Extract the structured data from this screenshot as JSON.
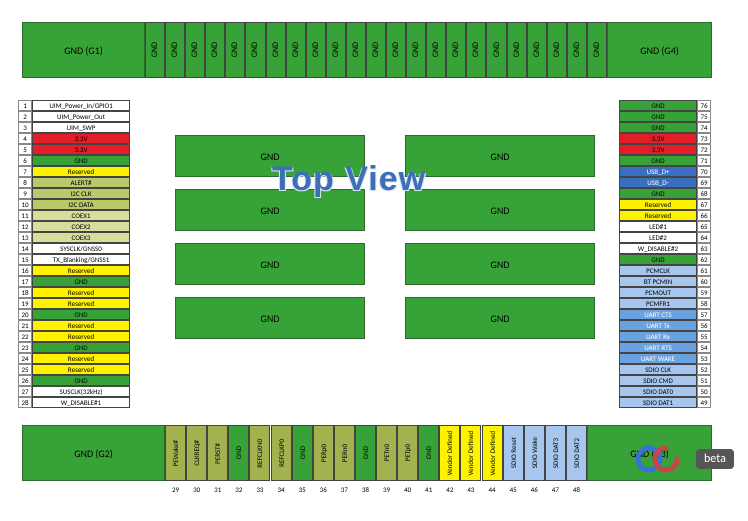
{
  "title": "Top View",
  "logo": {
    "text": "oc",
    "badge": "beta"
  },
  "colors": {
    "green": "#37a237",
    "greenDark": "#2e6a2e",
    "olive": "#bcc96b",
    "oliveDark": "#a3b24f",
    "yellow": "#fef200",
    "red": "#e41e26",
    "white": "#ffffff",
    "blue": "#3a6fbf",
    "blueMid": "#6aa2e0",
    "blueLight": "#a7c6ed",
    "oliveLight": "#d7dd9c"
  },
  "corner_blocks": {
    "G1": "GND (G1)",
    "G2": "GND (G2)",
    "G3": "GND (G3)",
    "G4": "GND (G4)"
  },
  "gnd_label": "GND",
  "inner_blocks_rows": 4,
  "inner_blocks_cols": 2,
  "inner_block_label": "GND",
  "top_strip": {
    "count": 23,
    "labelEach": "GND"
  },
  "left_pins": [
    {
      "n": 1,
      "label": "UIM_Power_In/GPIO1",
      "color": "white"
    },
    {
      "n": 2,
      "label": "UIM_Power_Out",
      "color": "white"
    },
    {
      "n": 3,
      "label": "UIM_SWP",
      "color": "white"
    },
    {
      "n": 4,
      "label": "3.3V",
      "color": "red"
    },
    {
      "n": 5,
      "label": "3.3V",
      "color": "red"
    },
    {
      "n": 6,
      "label": "GND",
      "color": "green"
    },
    {
      "n": 7,
      "label": "Reserved",
      "color": "yellow"
    },
    {
      "n": 8,
      "label": "ALERT#",
      "color": "olive"
    },
    {
      "n": 9,
      "label": "I2C CLK",
      "color": "olive"
    },
    {
      "n": 10,
      "label": "I2C DATA",
      "color": "olive"
    },
    {
      "n": 11,
      "label": "COEX1",
      "color": "oliveLight"
    },
    {
      "n": 12,
      "label": "COEX2",
      "color": "oliveLight"
    },
    {
      "n": 13,
      "label": "COEX3",
      "color": "oliveLight"
    },
    {
      "n": 14,
      "label": "SYSCLK/GNSS0",
      "color": "white"
    },
    {
      "n": 15,
      "label": "TX_Blanking/GNSS1",
      "color": "white"
    },
    {
      "n": 16,
      "label": "Reserved",
      "color": "yellow"
    },
    {
      "n": 17,
      "label": "GND",
      "color": "green"
    },
    {
      "n": 18,
      "label": "Reserved",
      "color": "yellow"
    },
    {
      "n": 19,
      "label": "Reserved",
      "color": "yellow"
    },
    {
      "n": 20,
      "label": "GND",
      "color": "green"
    },
    {
      "n": 21,
      "label": "Reserved",
      "color": "yellow"
    },
    {
      "n": 22,
      "label": "Reserved",
      "color": "yellow"
    },
    {
      "n": 23,
      "label": "GND",
      "color": "green"
    },
    {
      "n": 24,
      "label": "Reserved",
      "color": "yellow"
    },
    {
      "n": 25,
      "label": "Reserved",
      "color": "yellow"
    },
    {
      "n": 26,
      "label": "GND",
      "color": "green"
    },
    {
      "n": 27,
      "label": "SUSCLK(32kHz)",
      "color": "white"
    },
    {
      "n": 28,
      "label": "W_DISABLE#1",
      "color": "white"
    }
  ],
  "right_pins": [
    {
      "n": 76,
      "label": "GND",
      "color": "green"
    },
    {
      "n": 75,
      "label": "GND",
      "color": "green"
    },
    {
      "n": 74,
      "label": "GND",
      "color": "green"
    },
    {
      "n": 73,
      "label": "3.3V",
      "color": "red"
    },
    {
      "n": 72,
      "label": "3.3V",
      "color": "red"
    },
    {
      "n": 71,
      "label": "GND",
      "color": "green"
    },
    {
      "n": 70,
      "label": "USB_D+",
      "color": "blue"
    },
    {
      "n": 69,
      "label": "USB_D-",
      "color": "blue"
    },
    {
      "n": 68,
      "label": "GND",
      "color": "green"
    },
    {
      "n": 67,
      "label": "Reserved",
      "color": "yellow"
    },
    {
      "n": 66,
      "label": "Reserved",
      "color": "yellow"
    },
    {
      "n": 65,
      "label": "LED#1",
      "color": "white"
    },
    {
      "n": 64,
      "label": "LED#2",
      "color": "white"
    },
    {
      "n": 63,
      "label": "W_DISABLE#2",
      "color": "white"
    },
    {
      "n": 62,
      "label": "GND",
      "color": "green"
    },
    {
      "n": 61,
      "label": "PCMCLK",
      "color": "blueLight"
    },
    {
      "n": 60,
      "label": "BT PCMIN",
      "color": "blueLight"
    },
    {
      "n": 59,
      "label": "PCMOUT",
      "color": "blueLight"
    },
    {
      "n": 58,
      "label": "PCMFR1",
      "color": "blueLight"
    },
    {
      "n": 57,
      "label": "UART CTS",
      "color": "blueMid"
    },
    {
      "n": 56,
      "label": "UART Tx",
      "color": "blueMid"
    },
    {
      "n": 55,
      "label": "UART Rx",
      "color": "blueMid"
    },
    {
      "n": 54,
      "label": "UART RTS",
      "color": "blueMid"
    },
    {
      "n": 53,
      "label": "UART WAKE",
      "color": "blueMid"
    },
    {
      "n": 52,
      "label": "SDIO CLK",
      "color": "blueLight"
    },
    {
      "n": 51,
      "label": "SDIO CMD",
      "color": "blueLight"
    },
    {
      "n": 50,
      "label": "SDIO DAT0",
      "color": "blueLight"
    },
    {
      "n": 49,
      "label": "SDIO DAT1",
      "color": "blueLight"
    }
  ],
  "bottom_pins": [
    {
      "n": 29,
      "label": "PEWake#",
      "color": "oliveDark"
    },
    {
      "n": 30,
      "label": "CLKREQ#",
      "color": "oliveDark"
    },
    {
      "n": 31,
      "label": "PERST#",
      "color": "oliveDark"
    },
    {
      "n": 32,
      "label": "GND",
      "color": "green"
    },
    {
      "n": 33,
      "label": "REFCLKN0",
      "color": "oliveDark"
    },
    {
      "n": 34,
      "label": "REFCLKP0",
      "color": "oliveDark"
    },
    {
      "n": 35,
      "label": "GND",
      "color": "green"
    },
    {
      "n": 36,
      "label": "PERp0",
      "color": "oliveDark"
    },
    {
      "n": 37,
      "label": "PERn0",
      "color": "oliveDark"
    },
    {
      "n": 38,
      "label": "GND",
      "color": "green"
    },
    {
      "n": 39,
      "label": "PETn0",
      "color": "oliveDark"
    },
    {
      "n": 40,
      "label": "PETp0",
      "color": "oliveDark"
    },
    {
      "n": 41,
      "label": "GND",
      "color": "green"
    },
    {
      "n": 42,
      "label": "Vendor Defined",
      "color": "yellow"
    },
    {
      "n": 43,
      "label": "Vendor Defined",
      "color": "yellow"
    },
    {
      "n": 44,
      "label": "Vendor Defined",
      "color": "yellow"
    },
    {
      "n": 45,
      "label": "SDIO Reset",
      "color": "blueLight"
    },
    {
      "n": 46,
      "label": "SDIO Wake",
      "color": "blueLight"
    },
    {
      "n": 47,
      "label": "SDIO DAT3",
      "color": "blueLight"
    },
    {
      "n": 48,
      "label": "SDIO DAT2",
      "color": "blueLight"
    }
  ]
}
